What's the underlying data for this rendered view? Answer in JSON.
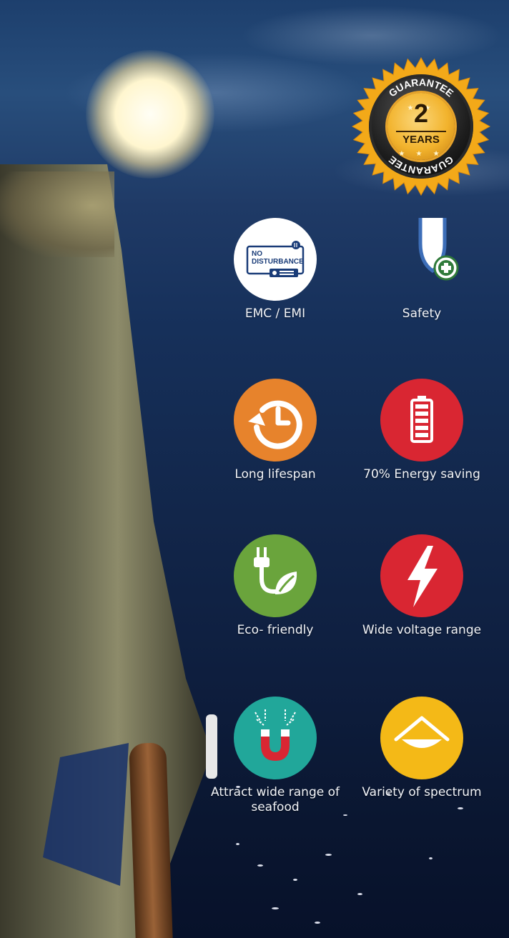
{
  "badge": {
    "top_text": "GUARANTEE",
    "number": "2",
    "unit": "YEARS",
    "bottom_text": "GUARANTEE"
  },
  "features": [
    {
      "label": "EMC / EMI",
      "icon": "no-disturbance-icon",
      "icon_text_1": "NO",
      "icon_text_2": "DISTURBANCE",
      "color": "#ffffff"
    },
    {
      "label": "Safety",
      "icon": "shield-plus-icon",
      "color": "#3d6eb8"
    },
    {
      "label": "Long lifespan",
      "icon": "clock-history-icon",
      "color": "#e7832c"
    },
    {
      "label": "70% Energy saving",
      "icon": "battery-icon",
      "color": "#d92632"
    },
    {
      "label": "Eco- friendly",
      "icon": "plug-leaf-icon",
      "color": "#6aa43c"
    },
    {
      "label": "Wide voltage range",
      "icon": "lightning-icon",
      "color": "#d92632"
    },
    {
      "label": "Attract wide range of seafood",
      "icon": "magnet-icon",
      "color": "#21a79a"
    },
    {
      "label": "Variety of spectrum",
      "icon": "spectrum-icon",
      "color": "#f4b917"
    }
  ]
}
